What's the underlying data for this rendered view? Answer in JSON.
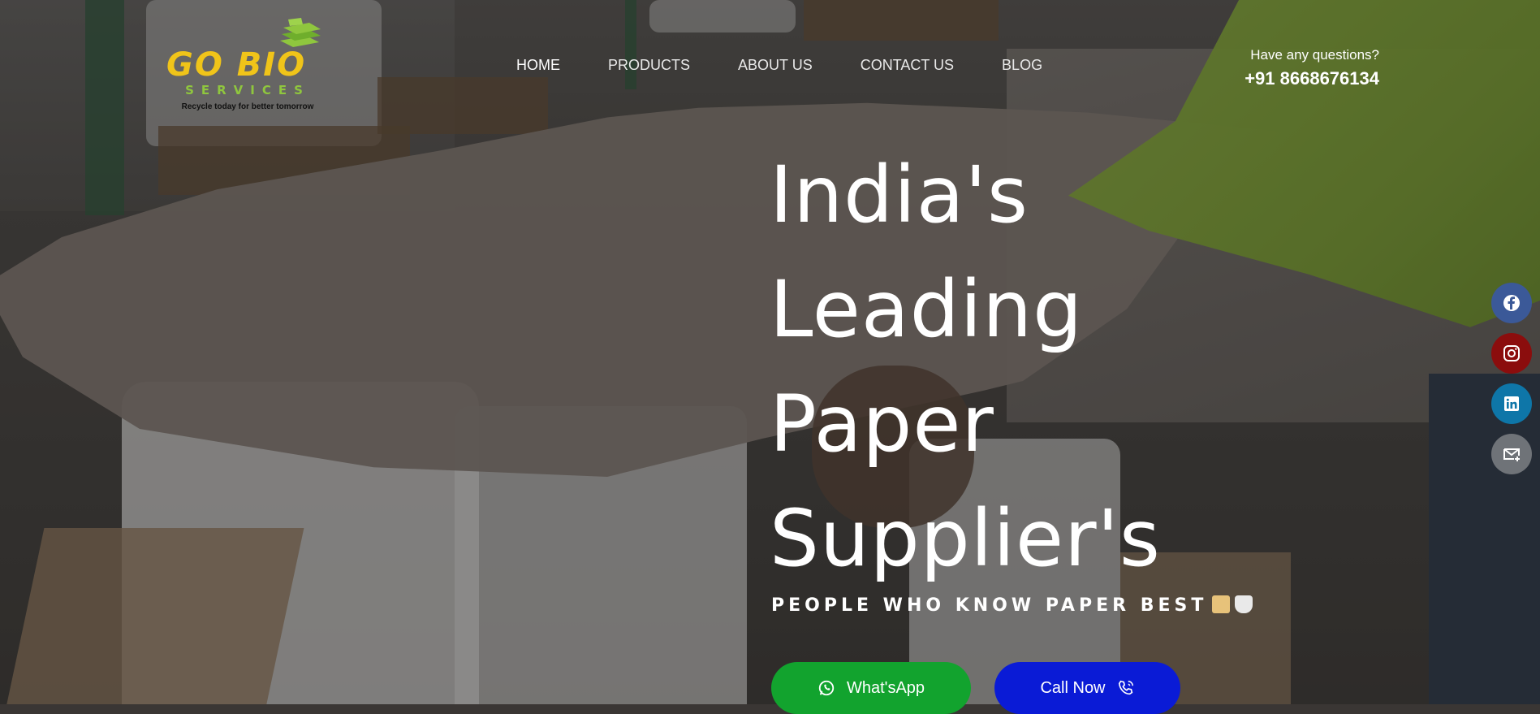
{
  "brand": {
    "name": "GO BIO",
    "subtitle": "SERVICES",
    "tagline": "Recycle today for better tomorrow",
    "colors": {
      "primary": "#f0c419",
      "secondary": "#8fc63e"
    }
  },
  "nav": {
    "items": [
      {
        "label": "HOME",
        "active": true
      },
      {
        "label": "PRODUCTS",
        "active": false
      },
      {
        "label": "ABOUT US",
        "active": false
      },
      {
        "label": "CONTACT US",
        "active": false
      },
      {
        "label": "BLOG",
        "active": false
      }
    ]
  },
  "contact": {
    "question": "Have any questions?",
    "phone": "+91 8668676134"
  },
  "hero": {
    "headline_lines": [
      "India's",
      "Leading",
      "Paper",
      "Supplier's"
    ],
    "tagline": "PEOPLE WHO KNOW PAPER BEST",
    "tagline_icons": [
      "scroll-icon",
      "toilet-paper-roll-icon"
    ],
    "buttons": {
      "whatsapp": {
        "label": "What'sApp",
        "icon": "whatsapp-icon",
        "color": "#12a32e"
      },
      "call": {
        "label": "Call Now",
        "icon": "phone-icon",
        "color": "#0a1bd6"
      }
    }
  },
  "social": [
    {
      "name": "facebook",
      "icon": "facebook-icon",
      "color": "#3b5998"
    },
    {
      "name": "instagram",
      "icon": "instagram-icon",
      "color": "#8b0d0d"
    },
    {
      "name": "linkedin",
      "icon": "linkedin-icon",
      "color": "#0e76a8"
    },
    {
      "name": "email",
      "icon": "mail-icon",
      "color": "#6f7378"
    }
  ]
}
